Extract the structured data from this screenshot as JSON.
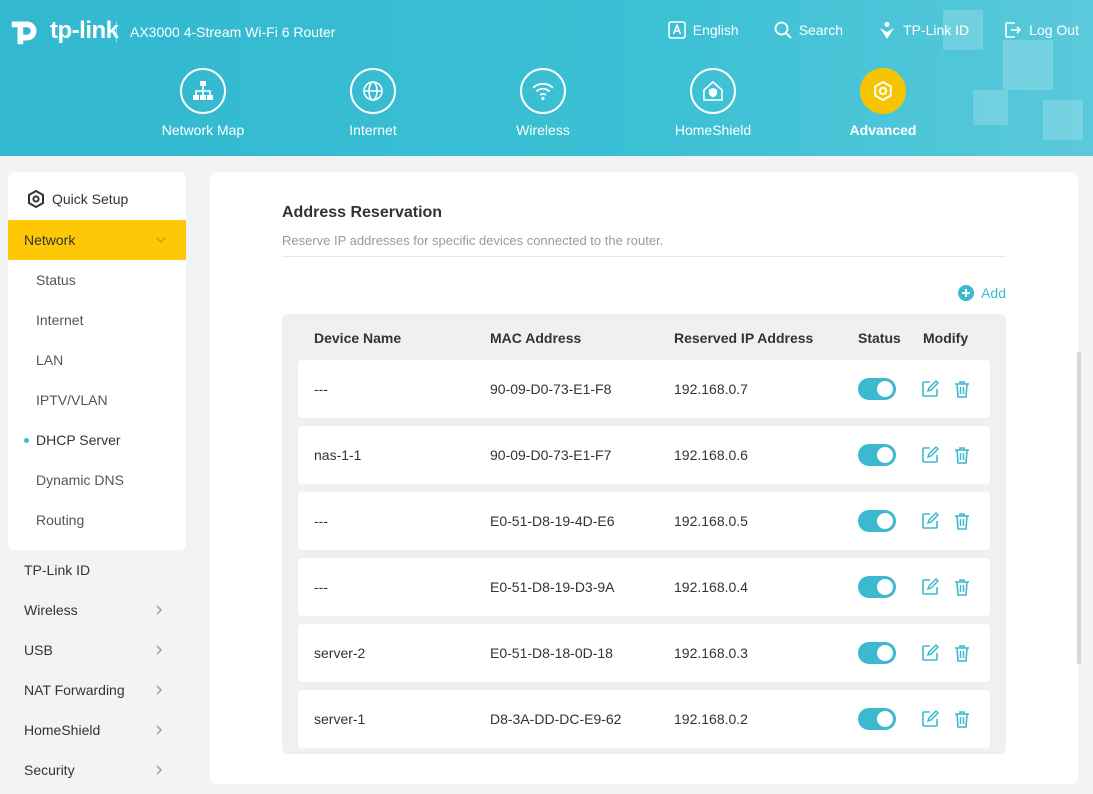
{
  "header": {
    "brand": "tp-link",
    "model": "AX3000 4-Stream Wi-Fi 6 Router",
    "topnav": [
      {
        "label": "English",
        "icon": "language-icon"
      },
      {
        "label": "Search",
        "icon": "search-icon"
      },
      {
        "label": "TP-Link ID",
        "icon": "tplink-id-icon"
      },
      {
        "label": "Log Out",
        "icon": "logout-icon"
      }
    ],
    "mainnav": [
      {
        "label": "Network Map",
        "icon": "network-map-icon",
        "active": false
      },
      {
        "label": "Internet",
        "icon": "globe-icon",
        "active": false
      },
      {
        "label": "Wireless",
        "icon": "wifi-icon",
        "active": false
      },
      {
        "label": "HomeShield",
        "icon": "homeshield-icon",
        "active": false
      },
      {
        "label": "Advanced",
        "icon": "gear-icon",
        "active": true
      }
    ],
    "accent": "#fec806"
  },
  "sidebar": {
    "quick_setup": "Quick Setup",
    "network": "Network",
    "network_sub": [
      "Status",
      "Internet",
      "LAN",
      "IPTV/VLAN",
      "DHCP Server",
      "Dynamic DNS",
      "Routing"
    ],
    "active_sub": "DHCP Server",
    "items": [
      "TP-Link ID",
      "Wireless",
      "USB",
      "NAT Forwarding",
      "HomeShield",
      "Security"
    ]
  },
  "section": {
    "title": "Address Reservation",
    "description": "Reserve IP addresses for specific devices connected to the router.",
    "add_label": "Add"
  },
  "table": {
    "headers": [
      "Device Name",
      "MAC Address",
      "Reserved IP Address",
      "Status",
      "Modify"
    ],
    "rows": [
      {
        "name": "---",
        "mac": "90-09-D0-73-E1-F8",
        "ip": "192.168.0.7",
        "enabled": true
      },
      {
        "name": "nas-1-1",
        "mac": "90-09-D0-73-E1-F7",
        "ip": "192.168.0.6",
        "enabled": true
      },
      {
        "name": "---",
        "mac": "E0-51-D8-19-4D-E6",
        "ip": "192.168.0.5",
        "enabled": true
      },
      {
        "name": "---",
        "mac": "E0-51-D8-19-D3-9A",
        "ip": "192.168.0.4",
        "enabled": true
      },
      {
        "name": "server-2",
        "mac": "E0-51-D8-18-0D-18",
        "ip": "192.168.0.3",
        "enabled": true
      },
      {
        "name": "server-1",
        "mac": "D8-3A-DD-DC-E9-62",
        "ip": "192.168.0.2",
        "enabled": true
      }
    ]
  },
  "colors": {
    "primary": "#3db9cf",
    "header_bg": "#35bbd1",
    "highlight": "#fec806"
  }
}
